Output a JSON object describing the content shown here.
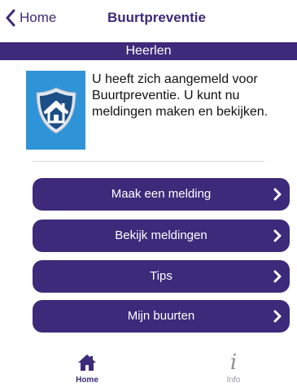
{
  "navbar": {
    "back_label": "Home",
    "title": "Buurtpreventie"
  },
  "city": {
    "name": "Heerlen"
  },
  "info": {
    "message": "U heeft zich aangemeld voor Buurtpreventie. U kunt nu meldingen maken en bekijken.",
    "logo_icon": "house-shield-icon"
  },
  "menu": {
    "items": [
      {
        "label": "Maak een melding"
      },
      {
        "label": "Bekijk meldingen"
      },
      {
        "label": "Tips"
      },
      {
        "label": "Mijn buurten"
      }
    ]
  },
  "tabbar": {
    "tabs": [
      {
        "label": "Home",
        "icon": "house-icon",
        "active": true
      },
      {
        "label": "Info",
        "icon": "info-icon",
        "active": false
      }
    ]
  },
  "colors": {
    "accent": "#3d2a7a",
    "logo_background": "#2f93d8",
    "inactive_tab": "#9a9aa2"
  }
}
